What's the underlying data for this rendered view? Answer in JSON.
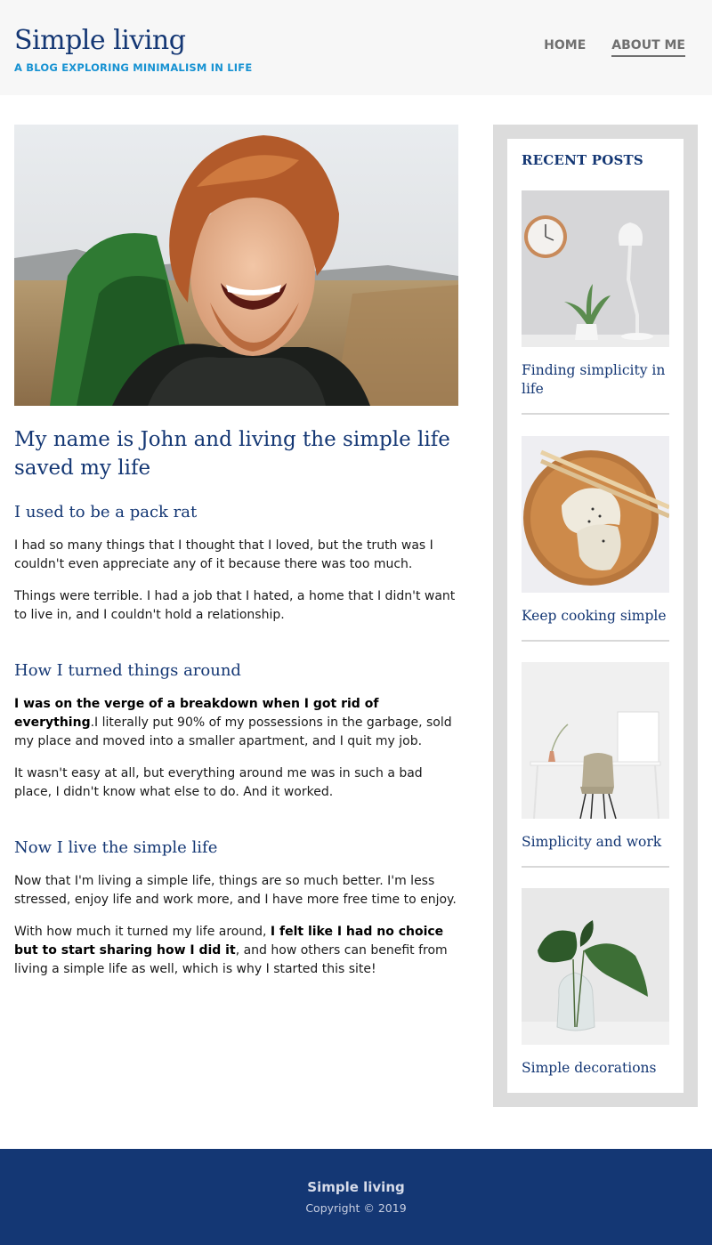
{
  "header": {
    "logo": "Simple living",
    "tagline": "A BLOG EXPLORING MINIMALISM IN LIFE",
    "nav": [
      {
        "label": "HOME"
      },
      {
        "label": "ABOUT ME"
      }
    ]
  },
  "article": {
    "title": "My name is John and living the simple life saved my life",
    "sections": [
      {
        "heading": "I used to be a pack rat",
        "paragraphs": [
          "I had so many things that I thought that I loved, but the truth was I couldn't even appreciate any of it because there was too much.",
          "Things were terrible. I had a job that I hated, a home that I didn't want to live in, and I couldn't hold a relationship."
        ]
      },
      {
        "heading": "How I turned things around",
        "p1_bold": "I was on the verge of a breakdown when I got rid of everything",
        "p1_rest": ".I literally put 90% of my possessions in the garbage, sold my place and moved into a smaller apartment, and I quit my job.",
        "p2": "It wasn't easy at all, but everything around me was in such a bad place, I didn't know what else to do. And it worked."
      },
      {
        "heading": "Now I live the simple life",
        "p1": "Now that I'm living a simple life, things are so much better. I'm less stressed, enjoy life and work more, and I have more free time to enjoy.",
        "p2_start": "With how much it turned my life around, ",
        "p2_bold": "I felt like I had no choice but to start sharing how I did it",
        "p2_end": ", and how others can benefit from living a simple life as well, which is why I started this site!"
      }
    ]
  },
  "sidebar": {
    "title": "RECENT POSTS",
    "posts": [
      {
        "title": "Finding simplicity in life"
      },
      {
        "title": "Keep cooking simple"
      },
      {
        "title": "Simplicity and work"
      },
      {
        "title": "Simple decorations"
      }
    ]
  },
  "footer": {
    "name": "Simple living",
    "copyright": "Copyright © 2019"
  }
}
